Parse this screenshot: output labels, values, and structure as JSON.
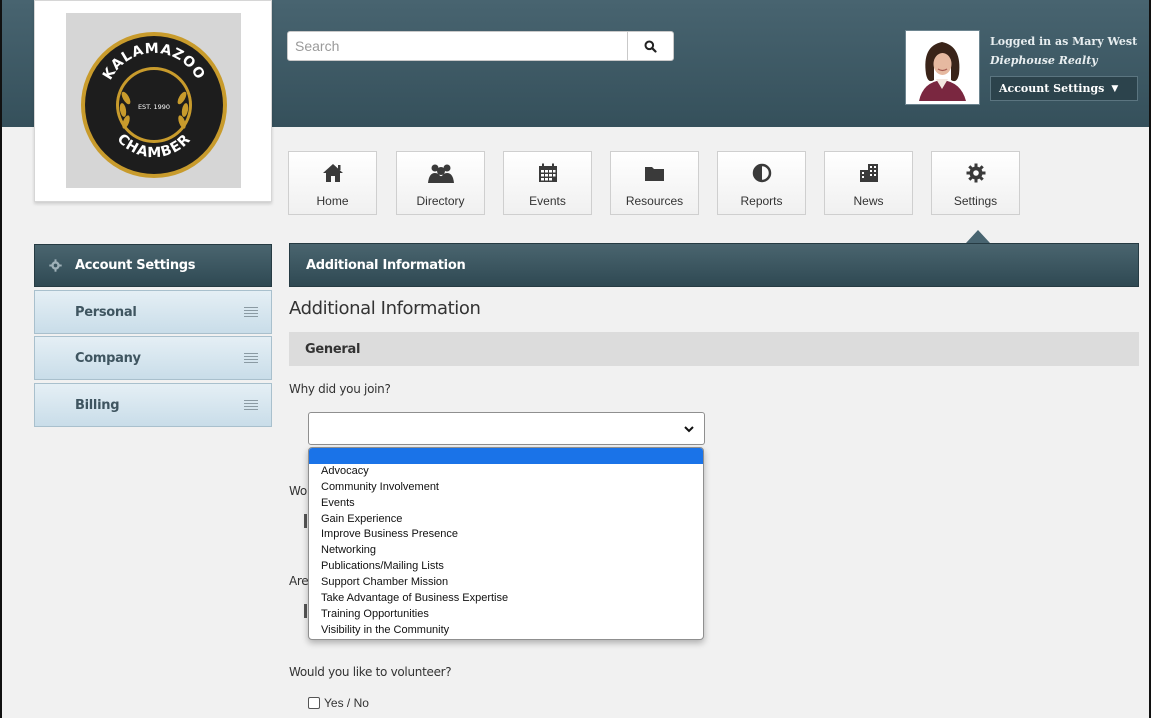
{
  "header": {
    "search": {
      "placeholder": "Search"
    },
    "user": {
      "logged_in_text": "Logged in as Mary West",
      "company": "Diephouse Realty",
      "account_button": "Account Settings"
    }
  },
  "logo": {
    "top_text": "KALAMAZOO",
    "bottom_text": "CHAMBER",
    "est": "EST. 1990"
  },
  "nav": {
    "tiles": [
      {
        "label": "Home",
        "icon": "home-icon"
      },
      {
        "label": "Directory",
        "icon": "people-icon"
      },
      {
        "label": "Events",
        "icon": "calendar-icon"
      },
      {
        "label": "Resources",
        "icon": "folder-icon"
      },
      {
        "label": "Reports",
        "icon": "pie-chart-icon"
      },
      {
        "label": "News",
        "icon": "building-icon"
      },
      {
        "label": "Settings",
        "icon": "gear-icon"
      }
    ],
    "active": "Settings"
  },
  "sidebar": {
    "header": "Account Settings",
    "items": [
      {
        "label": "Personal"
      },
      {
        "label": "Company"
      },
      {
        "label": "Billing"
      }
    ]
  },
  "main": {
    "panel_title": "Additional Information",
    "page_title": "Additional Information",
    "section": "General",
    "questions": {
      "q1": "Why did you join?",
      "q2_partial": "Wo",
      "q3_partial": "Are",
      "q4": "Would you like to volunteer?"
    },
    "volunteer_checkbox_label": "Yes / No",
    "dropdown": {
      "selected": "",
      "options": [
        "",
        "Advocacy",
        "Community Involvement",
        "Events",
        "Gain Experience",
        "Improve Business Presence",
        "Networking",
        "Publications/Mailing Lists",
        "Support Chamber Mission",
        "Take Advantage of Business Expertise",
        "Training Opportunities",
        "Visibility in the Community"
      ]
    }
  },
  "colors": {
    "header_dark": "#35505b",
    "header_light": "#486470",
    "sidebar_item": "#d6e6f0",
    "highlight": "#1a73e8"
  }
}
